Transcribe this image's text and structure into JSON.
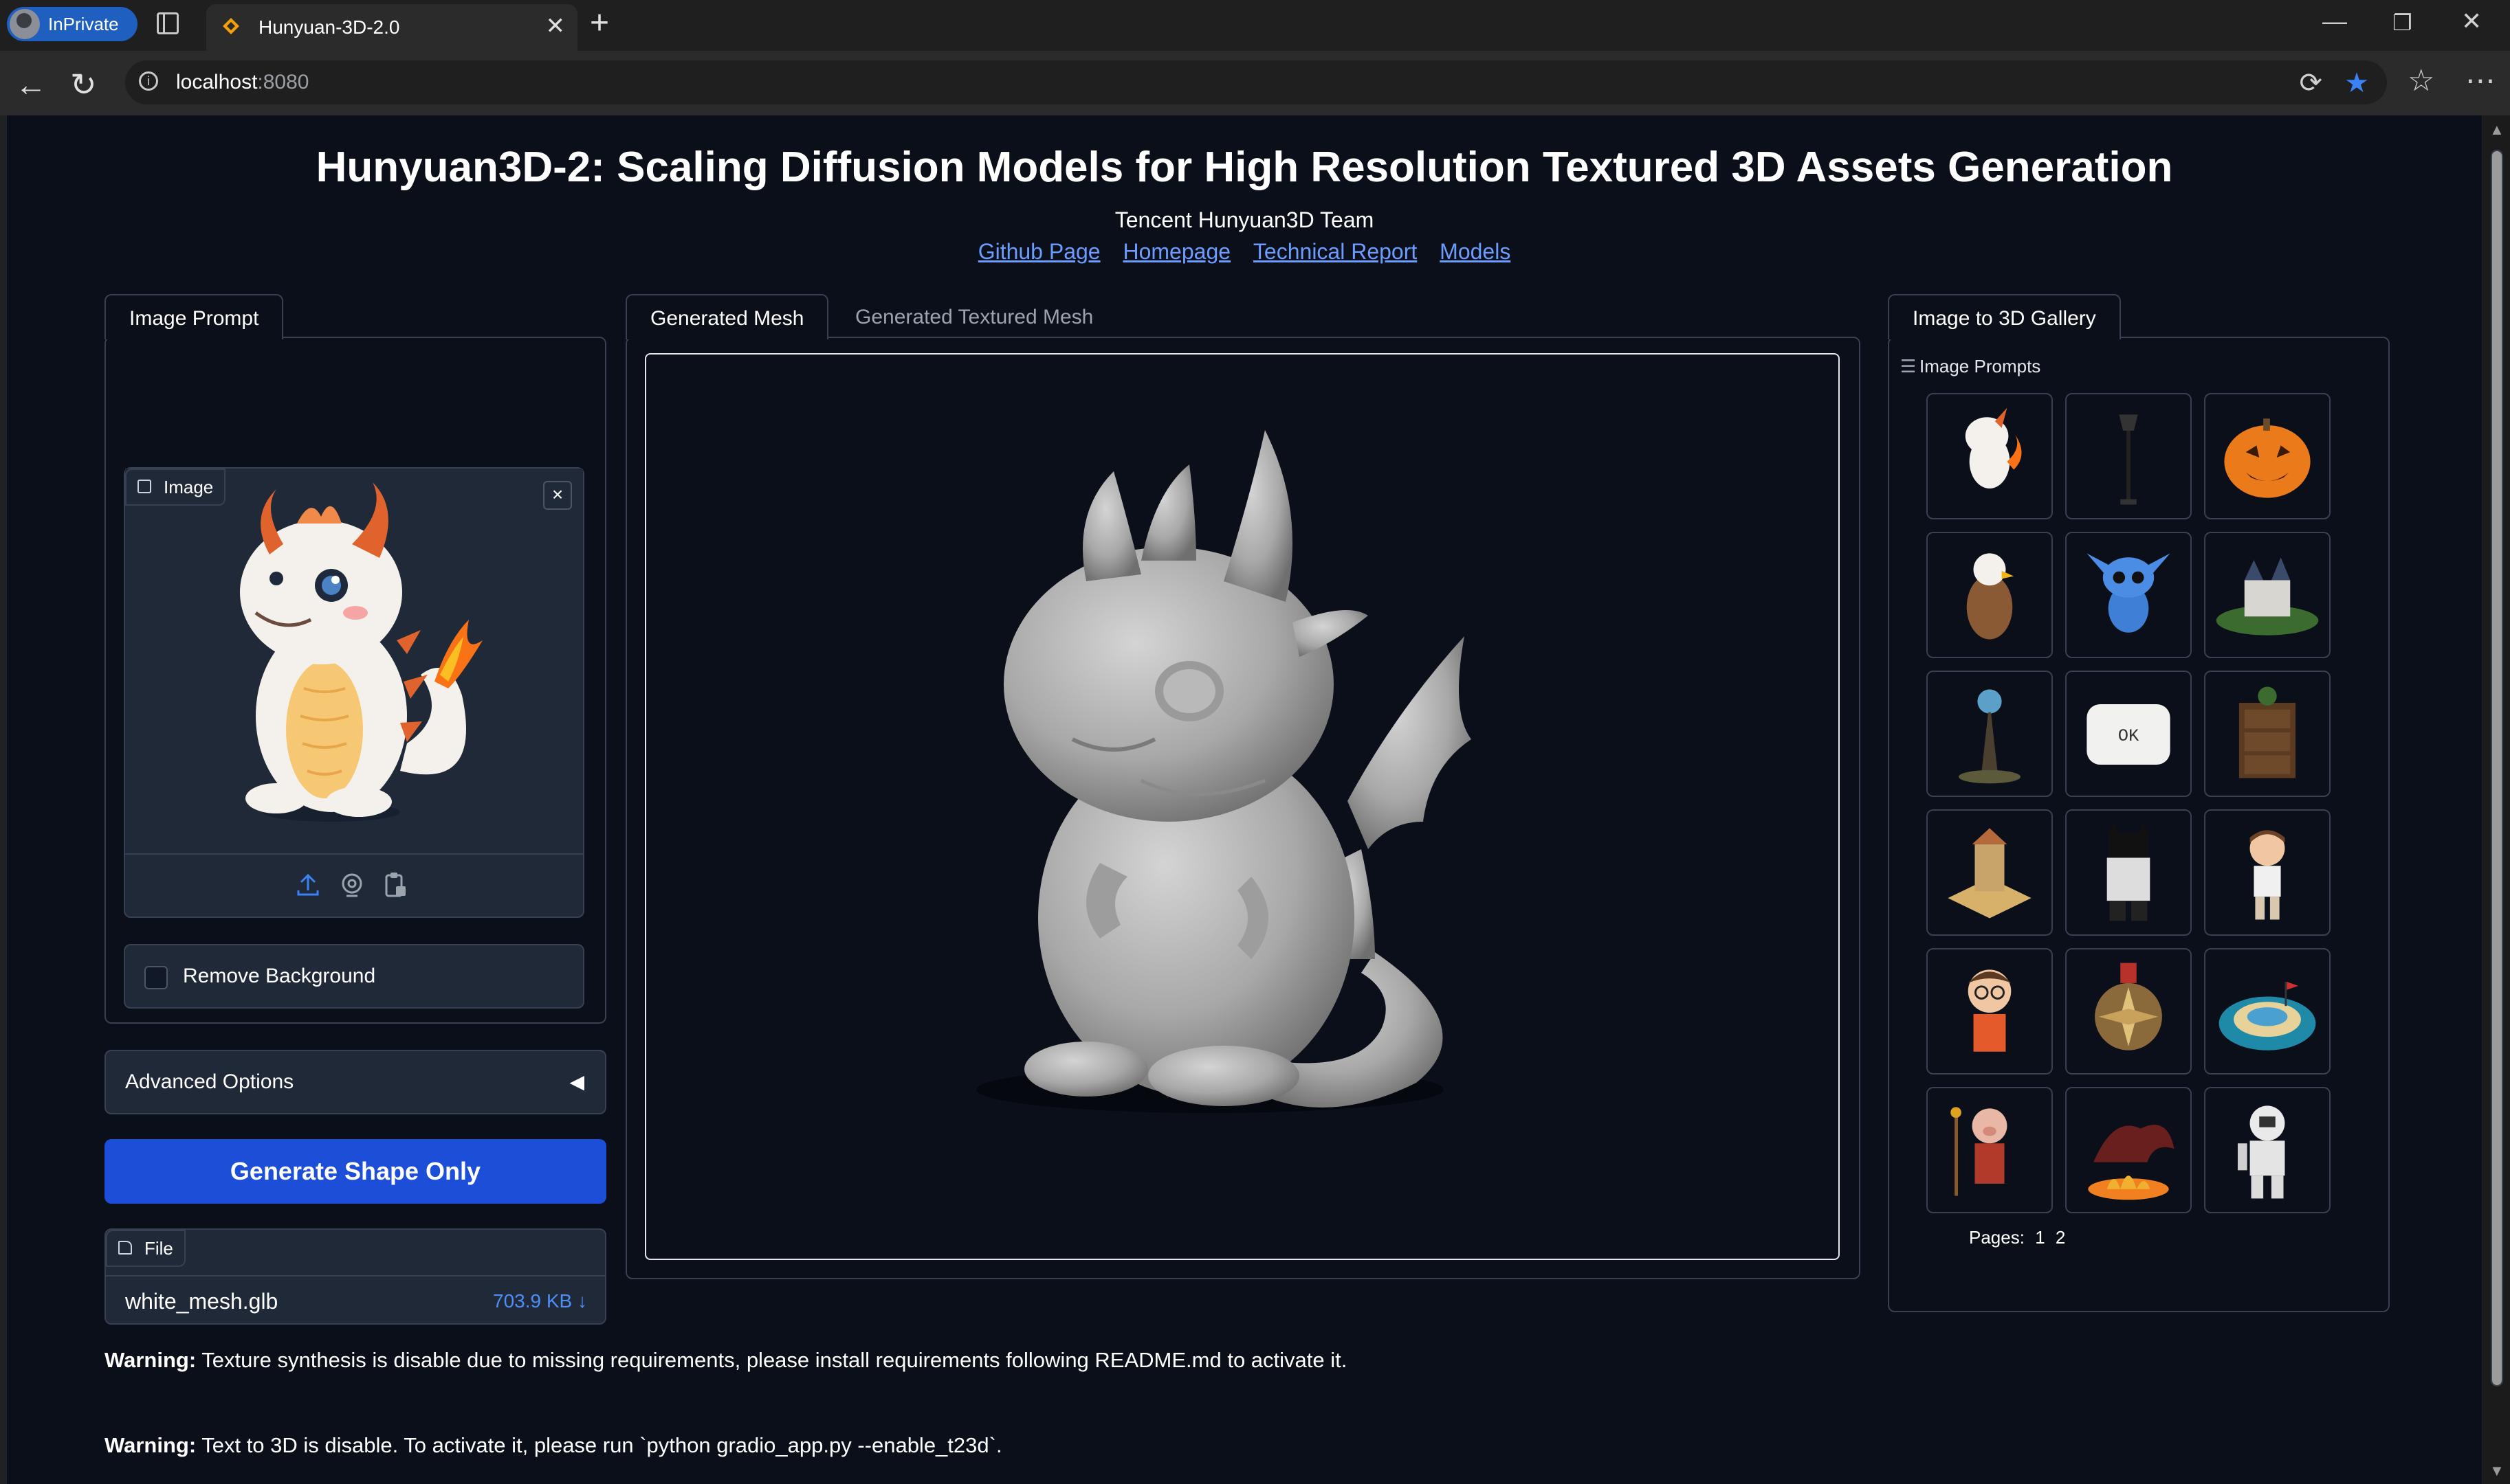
{
  "browser": {
    "inprivate_label": "InPrivate",
    "tab_title": "Hunyuan-3D-2.0",
    "url_host": "localhost",
    "url_port": ":8080"
  },
  "header": {
    "title": "Hunyuan3D-2: Scaling Diffusion Models for High Resolution Textured 3D Assets Generation",
    "team": "Tencent Hunyuan3D Team",
    "links": [
      "Github Page",
      "Homepage",
      "Technical Report",
      "Models"
    ]
  },
  "left": {
    "tab_label": "Image Prompt",
    "image_chip": "Image",
    "remove_bg_label": "Remove Background",
    "advanced_label": "Advanced Options",
    "generate_label": "Generate Shape Only",
    "file_chip": "File",
    "file_name": "white_mesh.glb",
    "file_size": "703.9 KB ↓"
  },
  "center": {
    "tabs": [
      "Generated Mesh",
      "Generated Textured Mesh"
    ]
  },
  "right": {
    "tab_label": "Image to 3D Gallery",
    "gallery_label": "Image Prompts",
    "thumbs": [
      "dragon",
      "street-lamp",
      "jack-o-lantern",
      "eagle",
      "stitch",
      "castle",
      "crystal-tree",
      "ok-pillow",
      "wooden-cabinet",
      "temple",
      "lego-batman",
      "boy-figure",
      "boy-glasses",
      "compass-medal",
      "island",
      "pig-warrior",
      "fire-dragon",
      "astronaut"
    ],
    "ok_text": "OK",
    "pages_label": "Pages:",
    "pages": [
      "1",
      "2"
    ]
  },
  "warnings": [
    {
      "label": "Warning:",
      "text": " Texture synthesis is disable due to missing requirements, please install requirements following README.md to activate it."
    },
    {
      "label": "Warning:",
      "text": " Text to 3D is disable. To activate it, please run `python gradio_app.py --enable_t23d`."
    }
  ]
}
